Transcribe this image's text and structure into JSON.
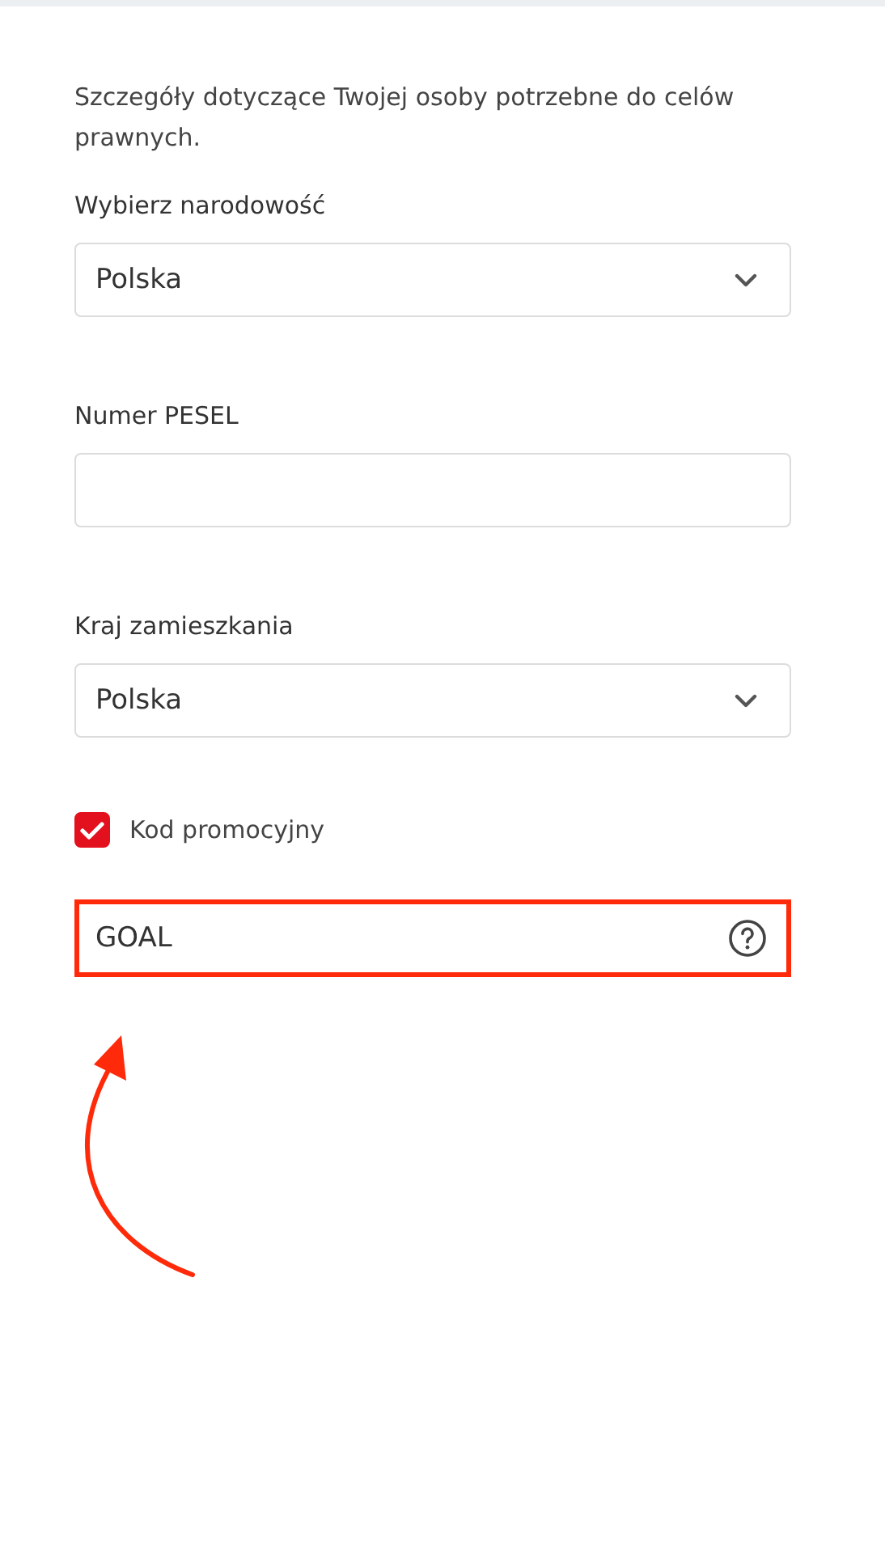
{
  "intro": "Szczegóły dotyczące Twojej osoby potrzebne do celów prawnych.",
  "fields": [
    {
      "kind": "select",
      "label": "Wybierz narodowość",
      "value": "Polska"
    },
    {
      "kind": "text",
      "label": "Numer PESEL"
    },
    {
      "kind": "select",
      "label": "Kraj zamieszkania",
      "value": "Polska"
    }
  ],
  "promo": {
    "label": "Kod promocyjny",
    "checked": true,
    "value": "GOAL",
    "highlighted": true
  }
}
